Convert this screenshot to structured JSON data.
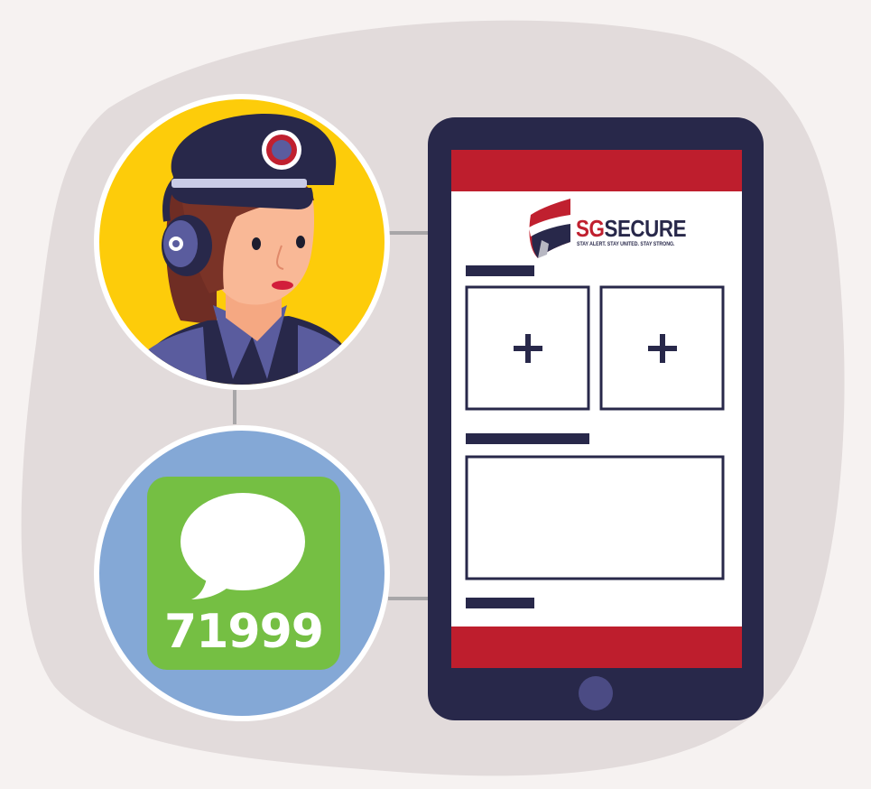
{
  "phone": {
    "logo": {
      "brand_sg": "SG",
      "brand_secure": "SECURE",
      "tagline": "STAY ALERT. STAY UNITED. STAY STRONG."
    },
    "add_photo_button_icon": "plus-icon",
    "colors": {
      "frame": "#28284a",
      "banner": "#be1e2d"
    }
  },
  "sms": {
    "number": "71999",
    "icon": "speech-bubble-icon",
    "colors": {
      "tile": "#75bf43",
      "circle": "#84a8d6"
    }
  },
  "officer": {
    "icon": "police-officer-with-headset",
    "colors": {
      "circle": "#fdcc0a"
    }
  }
}
